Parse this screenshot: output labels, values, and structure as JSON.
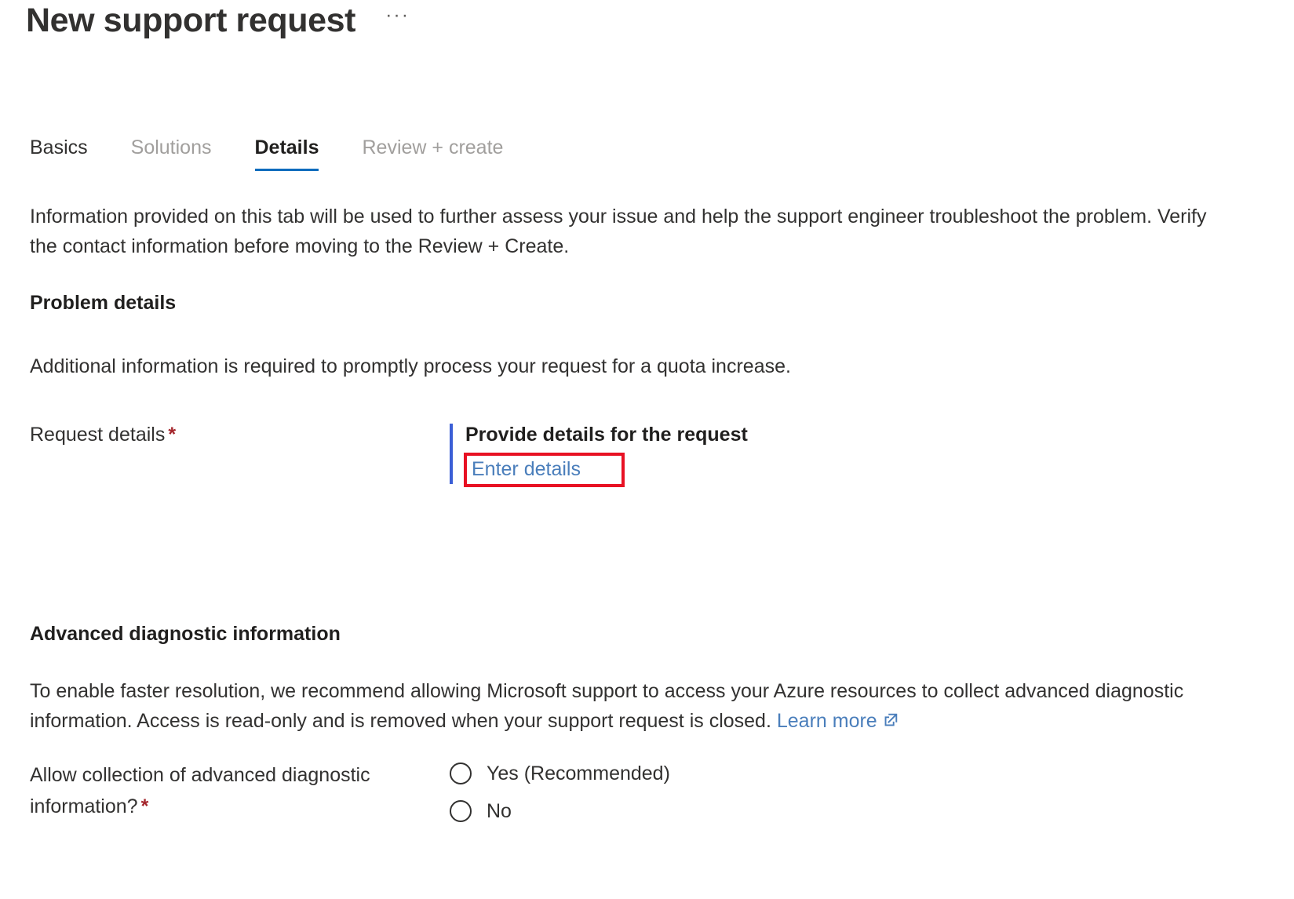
{
  "header": {
    "title": "New support request",
    "ellipsis": "···",
    "ellipsis_name": "more-options"
  },
  "tabs": [
    {
      "label": "Basics",
      "state": "visited"
    },
    {
      "label": "Solutions",
      "state": "disabled"
    },
    {
      "label": "Details",
      "state": "active"
    },
    {
      "label": "Review + create",
      "state": "disabled"
    }
  ],
  "intro": "Information provided on this tab will be used to further assess your issue and help the support engineer troubleshoot the problem. Verify the contact information before moving to the Review + Create.",
  "problem_details": {
    "heading": "Problem details",
    "paragraph": "Additional information is required to promptly process your request for a quota increase.",
    "request_details": {
      "label": "Request details",
      "required_marker": "*",
      "callout_title": "Provide details for the request",
      "link_label": "Enter details",
      "highlight_color": "#e81123",
      "accent_bar_color": "#3b5fd6"
    }
  },
  "advanced_diagnostics": {
    "heading": "Advanced diagnostic information",
    "paragraph_part1": "To enable faster resolution, we recommend allowing Microsoft support to access your Azure resources to collect advanced diagnostic information. Access is read-only and is removed when your support request is closed. ",
    "learn_more_label": "Learn more",
    "question_label": "Allow collection of advanced diagnostic information?",
    "required_marker": "*",
    "options": [
      {
        "label": "Yes (Recommended)",
        "selected": false
      },
      {
        "label": "No",
        "selected": false
      }
    ]
  },
  "colors": {
    "accent_blue": "#0f6cbd",
    "link_blue": "#4a7ebb",
    "required_red": "#a4262c",
    "highlight_red": "#e81123",
    "text": "#323130",
    "muted_text": "#a19f9d"
  }
}
